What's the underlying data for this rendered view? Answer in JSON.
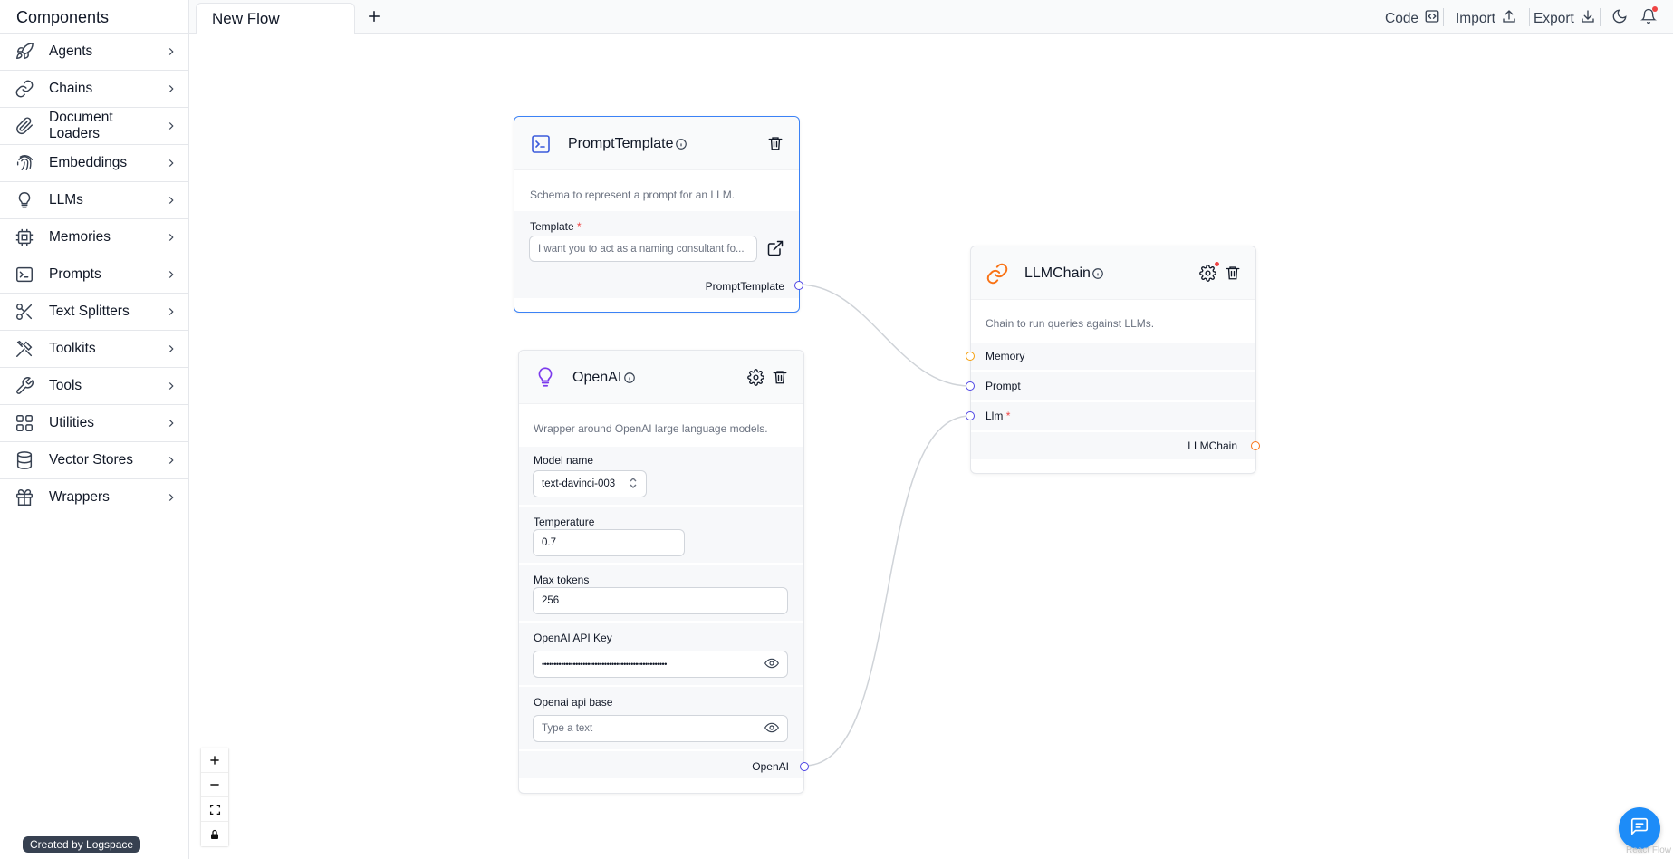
{
  "sidebar": {
    "title": "Components",
    "items": [
      {
        "label": "Agents",
        "icon": "rocket-icon"
      },
      {
        "label": "Chains",
        "icon": "link-icon"
      },
      {
        "label": "Document Loaders",
        "icon": "paperclip-icon"
      },
      {
        "label": "Embeddings",
        "icon": "fingerprint-icon"
      },
      {
        "label": "LLMs",
        "icon": "lightbulb-icon"
      },
      {
        "label": "Memories",
        "icon": "cpu-icon"
      },
      {
        "label": "Prompts",
        "icon": "terminal-icon"
      },
      {
        "label": "Text Splitters",
        "icon": "scissors-icon"
      },
      {
        "label": "Toolkits",
        "icon": "tools-icon"
      },
      {
        "label": "Tools",
        "icon": "wrench-icon"
      },
      {
        "label": "Utilities",
        "icon": "grid-icon"
      },
      {
        "label": "Vector Stores",
        "icon": "database-icon"
      },
      {
        "label": "Wrappers",
        "icon": "gift-icon"
      }
    ],
    "footer_badge": "Created by Logspace"
  },
  "topbar": {
    "tab_label": "New Flow",
    "code_label": "Code",
    "import_label": "Import",
    "export_label": "Export"
  },
  "nodes": {
    "prompt_template": {
      "title": "PromptTemplate",
      "description": "Schema to represent a prompt for an LLM.",
      "template_label": "Template",
      "template_required": "*",
      "template_value": "I want you to act as a naming consultant fo...",
      "output_label": "PromptTemplate"
    },
    "openai": {
      "title": "OpenAI",
      "description": "Wrapper around OpenAI large language models.",
      "model_name_label": "Model name",
      "model_name_value": "text-davinci-003",
      "temperature_label": "Temperature",
      "temperature_value": "0.7",
      "max_tokens_label": "Max tokens",
      "max_tokens_value": "256",
      "api_key_label": "OpenAI API Key",
      "api_key_value": "••••••••••••••••••••••••••••••••••••••••••••••••••••",
      "api_base_label": "Openai api base",
      "api_base_placeholder": "Type a text",
      "output_label": "OpenAI"
    },
    "llmchain": {
      "title": "LLMChain",
      "description": "Chain to run queries against LLMs.",
      "inputs": [
        "Memory",
        "Prompt",
        "Llm"
      ],
      "llm_required": "*",
      "output_label": "LLMChain"
    }
  },
  "colors": {
    "handle_blue": "#4f46e5",
    "handle_orange": "#f59e0b",
    "selected_border": "#3b82f6",
    "chat_button": "#1d8cf8"
  },
  "attribution": "React Flow"
}
